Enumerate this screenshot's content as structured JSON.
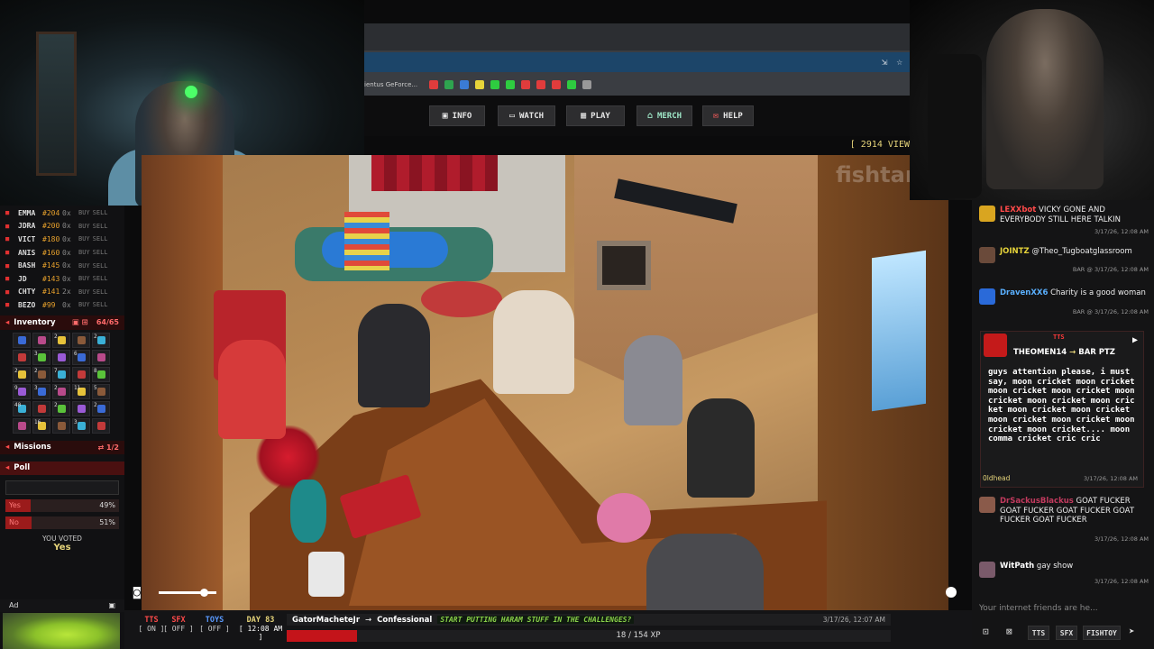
{
  "browser": {
    "bookmark_text": "ientus GeForce...",
    "bookmark_icons": [
      "#e03c3c",
      "#2ea44f",
      "#3a7bd5",
      "#e7d43a",
      "#2ecc40",
      "#2ecc40",
      "#e03c3c",
      "#e03c3c",
      "#e03c3c",
      "#2ecc40",
      "#999999"
    ]
  },
  "nav": {
    "info": "INFO",
    "watch": "WATCH",
    "play": "PLAY",
    "merch": "MERCH",
    "help": "HELP",
    "viewers": "[ 2914 VIEW"
  },
  "overlay": {
    "watermark": "fishtank"
  },
  "stocks": [
    {
      "name": "EMMA",
      "price": "#204",
      "qty": "0x"
    },
    {
      "name": "JDRA",
      "price": "#200",
      "qty": "0x"
    },
    {
      "name": "VICT",
      "price": "#180",
      "qty": "0x"
    },
    {
      "name": "ANIS",
      "price": "#160",
      "qty": "0x"
    },
    {
      "name": "BASH",
      "price": "#145",
      "qty": "0x"
    },
    {
      "name": "JD",
      "price": "#143",
      "qty": "0x"
    },
    {
      "name": "CHTY",
      "price": "#141",
      "qty": "2x"
    },
    {
      "name": "BEZO",
      "price": "#99",
      "qty": "0x"
    }
  ],
  "stock_labels": {
    "buy": "BUY",
    "sell": "SELL"
  },
  "inventory": {
    "title": "Inventory",
    "count": "64/65",
    "cells": [
      "",
      "",
      "2",
      "",
      "2",
      "",
      "3",
      "",
      "6",
      "",
      "2",
      "2",
      "7",
      "",
      "8",
      "9",
      "3",
      "2",
      "11",
      "5",
      "40",
      "",
      "2",
      "",
      "2",
      "",
      "16",
      "",
      "3",
      ""
    ]
  },
  "missions": {
    "title": "Missions",
    "count": "1/2"
  },
  "poll": {
    "title": "Poll",
    "options": [
      {
        "label": "Yes",
        "pct": "49%",
        "fill": 0.49
      },
      {
        "label": "No",
        "pct": "51%",
        "fill": 0.51
      }
    ],
    "voted_label": "YOU VOTED",
    "voted_value": "Yes"
  },
  "ad": {
    "label": "Ad"
  },
  "bottom": {
    "tts": {
      "label": "TTS",
      "state": "[ ON ]"
    },
    "sfx": {
      "label": "SFX",
      "state": "[ OFF ]"
    },
    "toys": {
      "label": "TOYS",
      "state": "[ OFF ]"
    },
    "day": {
      "label": "DAY 83",
      "time": "[ 12:08 AM ]"
    },
    "chat_user": "GatorMacheteJr",
    "chat_arrow": "→",
    "chat_room": "Confessional",
    "chat_text": "START PUTTING HARAM STUFF IN THE CHALLENGES?",
    "chat_time": "3/17/26, 12:07 AM",
    "xp_text": "18 / 154 XP",
    "xp_fraction": 0.117
  },
  "chat": {
    "messages": [
      {
        "user": "LEXXbot",
        "text": "VICKY GONE AND EVERYBODY STILL HERE TALKIN",
        "meta": "3/17/26, 12:08 AM",
        "color": "#ff4a4a",
        "avatar": "#d9a520"
      },
      {
        "user": "JOINTZ",
        "text": "@Theo_Tugboatglassroom",
        "meta": "BAR @ 3/17/26, 12:08 AM",
        "color": "#e7d43a",
        "avatar": "#6a4a3a"
      },
      {
        "user": "DravenXX6",
        "text": "Charity is a good woman",
        "meta": "BAR @ 3/17/26, 12:08 AM",
        "color": "#5ab0ff",
        "avatar": "#2a6ad9"
      },
      {
        "user": "DrSackusBlackus",
        "text": "GOAT FUCKER GOAT FUCKER GOAT FUCKER GOAT FUCKER GOAT FUCKER",
        "meta": "3/17/26, 12:08 AM",
        "color": "#c23a5e",
        "avatar": "#8a5a4a"
      },
      {
        "user": "WitPath",
        "text": "gay show",
        "meta": "3/17/26, 12:08 AM",
        "color": "#ffffff",
        "avatar": "#7a5a6a"
      }
    ],
    "tts": {
      "label": "TTS",
      "from": "THEOMEN14",
      "arrow": "→",
      "to": "BAR PTZ",
      "text": "guys attention please, i must say, moon cricket moon cricket moon cricket moon cricket moon cricket moon cricket moon cricket moon cricket moon cricket moon cricket moon cricket moon cricket moon cricket.... moon comma cricket cric cric",
      "user": "0ldhead",
      "meta": "3/17/26, 12:08 AM"
    },
    "input_placeholder": "Your internet friends are he...",
    "tools": {
      "tts": "TTS",
      "sfx": "SFX",
      "fishtoy": "FISHTOY"
    }
  }
}
